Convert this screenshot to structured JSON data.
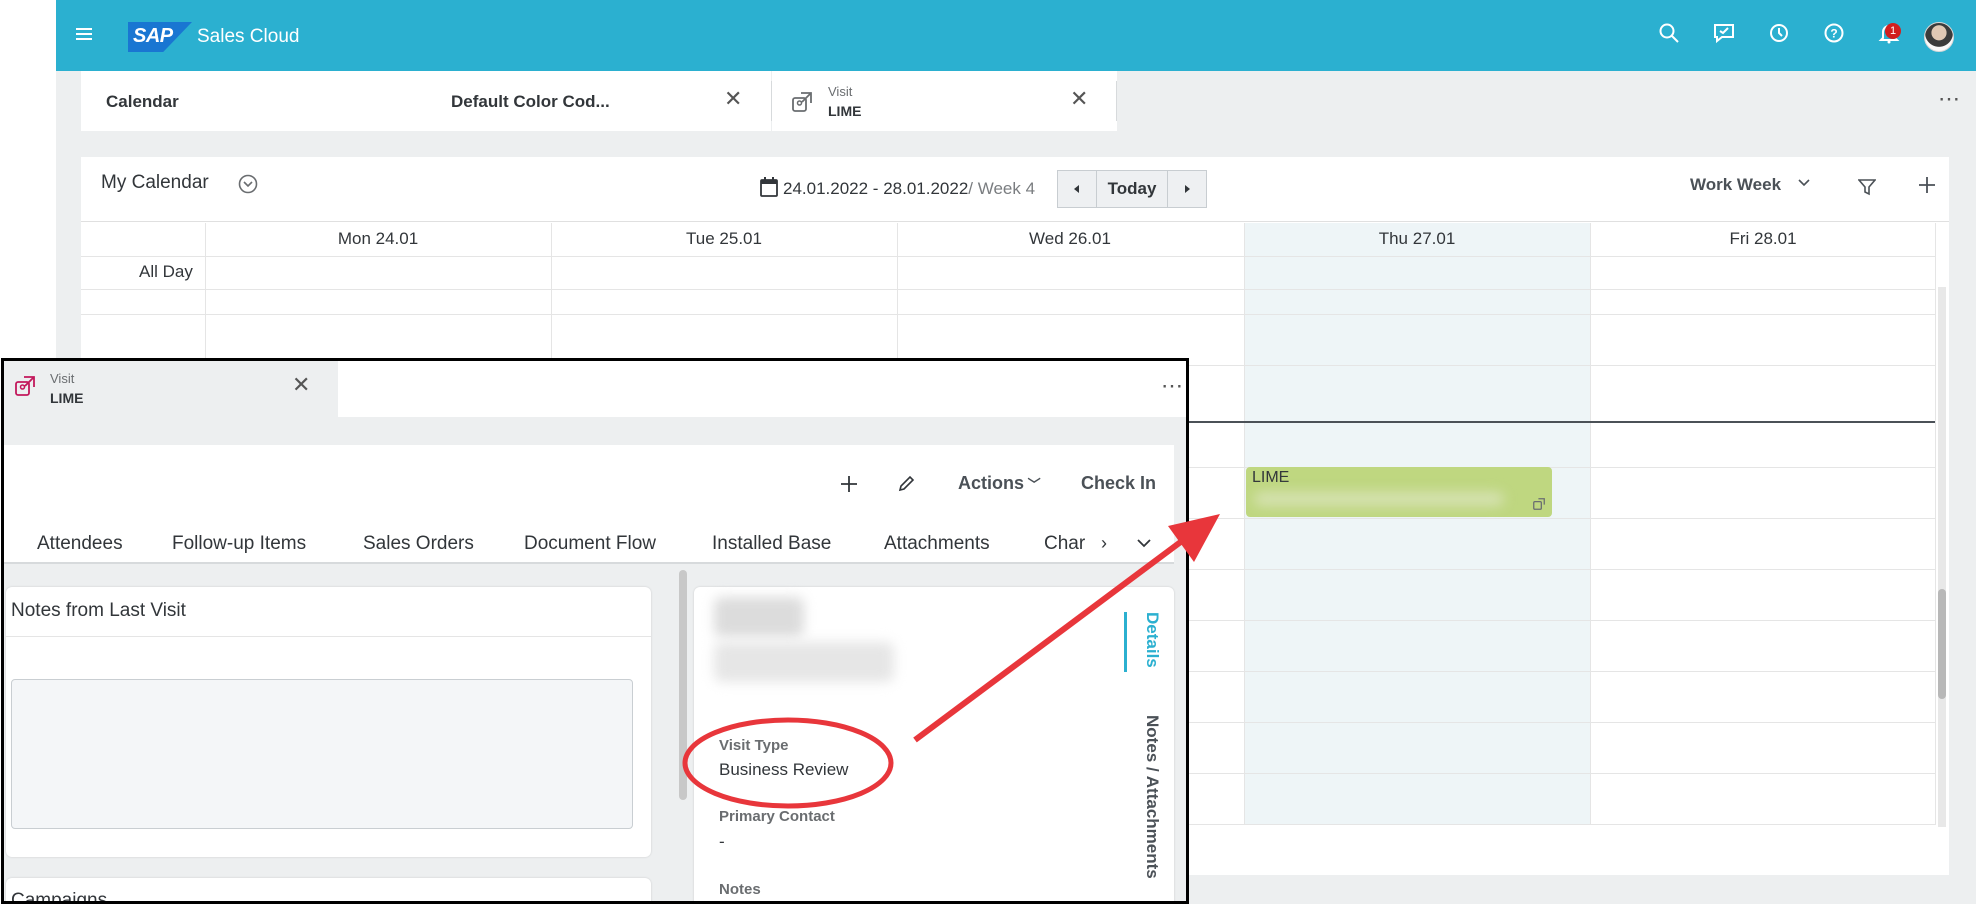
{
  "shell": {
    "app_title": "Sales Cloud",
    "logo_text": "SAP",
    "notification_count": "1",
    "header_icons": [
      "menu-icon",
      "search-icon",
      "feedback-icon",
      "history-icon",
      "help-icon",
      "bell-icon",
      "avatar"
    ]
  },
  "tabs": [
    {
      "label": "Calendar"
    },
    {
      "label": "Default Color Cod..."
    },
    {
      "small": "Visit",
      "big": "LIME"
    }
  ],
  "calendar": {
    "title": "My Calendar",
    "date_range": "24.01.2022 - 28.01.2022",
    "week": "/ Week 4",
    "today_label": "Today",
    "view_label": "Work Week",
    "all_day_label": "All Day",
    "days": [
      "Mon 24.01",
      "Tue 25.01",
      "Wed 26.01",
      "Thu 27.01",
      "Fri 28.01"
    ],
    "appointment": {
      "title": "LIME"
    }
  },
  "popup": {
    "tab_small": "Visit",
    "tab_big": "LIME",
    "toolbar": {
      "actions_label": "Actions",
      "checkin_label": "Check In"
    },
    "section_tabs": [
      "Attendees",
      "Follow-up Items",
      "Sales Orders",
      "Document Flow",
      "Installed Base",
      "Attachments",
      "Char"
    ],
    "notes_panel_title": "Notes from Last Visit",
    "next_panel_title": "Campaigns",
    "side_tabs": [
      "Details",
      "Notes / Attachments"
    ],
    "fields": [
      {
        "label": "Visit Type",
        "value": "Business Review"
      },
      {
        "label": "Primary Contact",
        "value": "-"
      },
      {
        "label": "Notes",
        "value": ""
      }
    ]
  },
  "colors": {
    "shell_bar": "#2bb0d0",
    "accent": "#2bb0d0",
    "appointment": "#bfd780",
    "annotation": "#e8363b",
    "today_column": "#eef5f7"
  }
}
